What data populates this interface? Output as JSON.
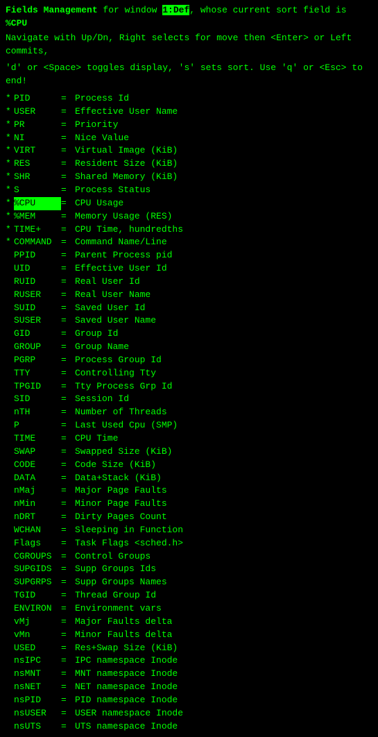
{
  "header": {
    "prefix": "Fields Management",
    "middle": " for window ",
    "highlight_text": "1:Def",
    "suffix": ", whose current sort field is ",
    "sort_field": "%CPU"
  },
  "nav1": "   Navigate with Up/Dn, Right selects for move then <Enter> or Left commits,",
  "nav2": "   'd' or <Space> toggles display, 's' sets sort.  Use 'q' or <Esc> to end!",
  "fields": [
    {
      "star": "*",
      "name": "PID",
      "desc": "Process Id",
      "highlighted": false
    },
    {
      "star": "*",
      "name": "USER",
      "desc": "Effective User Name",
      "highlighted": false
    },
    {
      "star": "*",
      "name": "PR",
      "desc": "Priority",
      "highlighted": false
    },
    {
      "star": "*",
      "name": "NI",
      "desc": "Nice Value",
      "highlighted": false
    },
    {
      "star": "*",
      "name": "VIRT",
      "desc": "Virtual Image (KiB)",
      "highlighted": false
    },
    {
      "star": "*",
      "name": "RES",
      "desc": "Resident Size (KiB)",
      "highlighted": false
    },
    {
      "star": "*",
      "name": "SHR",
      "desc": "Shared Memory (KiB)",
      "highlighted": false
    },
    {
      "star": "*",
      "name": "S",
      "desc": "Process Status",
      "highlighted": false
    },
    {
      "star": "*",
      "name": "%CPU",
      "desc": "CPU Usage",
      "highlighted": true
    },
    {
      "star": "*",
      "name": "%MEM",
      "desc": "Memory Usage (RES)",
      "highlighted": false
    },
    {
      "star": "*",
      "name": "TIME+",
      "desc": "CPU Time, hundredths",
      "highlighted": false
    },
    {
      "star": "*",
      "name": "COMMAND",
      "desc": "Command Name/Line",
      "highlighted": false
    },
    {
      "star": " ",
      "name": "PPID",
      "desc": "Parent Process pid",
      "highlighted": false
    },
    {
      "star": " ",
      "name": "UID",
      "desc": "Effective User Id",
      "highlighted": false
    },
    {
      "star": " ",
      "name": "RUID",
      "desc": "Real User Id",
      "highlighted": false
    },
    {
      "star": " ",
      "name": "RUSER",
      "desc": "Real User Name",
      "highlighted": false
    },
    {
      "star": " ",
      "name": "SUID",
      "desc": "Saved User Id",
      "highlighted": false
    },
    {
      "star": " ",
      "name": "SUSER",
      "desc": "Saved User Name",
      "highlighted": false
    },
    {
      "star": " ",
      "name": "GID",
      "desc": "Group Id",
      "highlighted": false
    },
    {
      "star": " ",
      "name": "GROUP",
      "desc": "Group Name",
      "highlighted": false
    },
    {
      "star": " ",
      "name": "PGRP",
      "desc": "Process Group Id",
      "highlighted": false
    },
    {
      "star": " ",
      "name": "TTY",
      "desc": "Controlling Tty",
      "highlighted": false
    },
    {
      "star": " ",
      "name": "TPGID",
      "desc": "Tty Process Grp Id",
      "highlighted": false
    },
    {
      "star": " ",
      "name": "SID",
      "desc": "Session Id",
      "highlighted": false
    },
    {
      "star": " ",
      "name": "nTH",
      "desc": "Number of Threads",
      "highlighted": false
    },
    {
      "star": " ",
      "name": "P",
      "desc": "Last Used Cpu (SMP)",
      "highlighted": false
    },
    {
      "star": " ",
      "name": "TIME",
      "desc": "CPU Time",
      "highlighted": false
    },
    {
      "star": " ",
      "name": "SWAP",
      "desc": "Swapped Size (KiB)",
      "highlighted": false
    },
    {
      "star": " ",
      "name": "CODE",
      "desc": "Code Size (KiB)",
      "highlighted": false
    },
    {
      "star": " ",
      "name": "DATA",
      "desc": "Data+Stack (KiB)",
      "highlighted": false
    },
    {
      "star": " ",
      "name": "nMaj",
      "desc": "Major Page Faults",
      "highlighted": false
    },
    {
      "star": " ",
      "name": "nMin",
      "desc": "Minor Page Faults",
      "highlighted": false
    },
    {
      "star": " ",
      "name": "nDRT",
      "desc": "Dirty Pages Count",
      "highlighted": false
    },
    {
      "star": " ",
      "name": "WCHAN",
      "desc": "Sleeping in Function",
      "highlighted": false
    },
    {
      "star": " ",
      "name": "Flags",
      "desc": "Task Flags <sched.h>",
      "highlighted": false
    },
    {
      "star": " ",
      "name": "CGROUPS",
      "desc": "Control Groups",
      "highlighted": false
    },
    {
      "star": " ",
      "name": "SUPGIDS",
      "desc": "Supp Groups Ids",
      "highlighted": false
    },
    {
      "star": " ",
      "name": "SUPGRPS",
      "desc": "Supp Groups Names",
      "highlighted": false
    },
    {
      "star": " ",
      "name": "TGID",
      "desc": "Thread Group Id",
      "highlighted": false
    },
    {
      "star": " ",
      "name": "ENVIRON",
      "desc": "Environment vars",
      "highlighted": false
    },
    {
      "star": " ",
      "name": "vMj",
      "desc": "Major Faults delta",
      "highlighted": false
    },
    {
      "star": " ",
      "name": "vMn",
      "desc": "Minor Faults delta",
      "highlighted": false
    },
    {
      "star": " ",
      "name": "USED",
      "desc": "Res+Swap Size (KiB)",
      "highlighted": false
    },
    {
      "star": " ",
      "name": "nsIPC",
      "desc": "IPC namespace Inode",
      "highlighted": false
    },
    {
      "star": " ",
      "name": "nsMNT",
      "desc": "MNT namespace Inode",
      "highlighted": false
    },
    {
      "star": " ",
      "name": "nsNET",
      "desc": "NET namespace Inode",
      "highlighted": false
    },
    {
      "star": " ",
      "name": "nsPID",
      "desc": "PID namespace Inode",
      "highlighted": false
    },
    {
      "star": " ",
      "name": "nsUSER",
      "desc": "USER namespace Inode",
      "highlighted": false
    },
    {
      "star": " ",
      "name": "nsUTS",
      "desc": "UTS namespace Inode",
      "highlighted": false
    }
  ]
}
